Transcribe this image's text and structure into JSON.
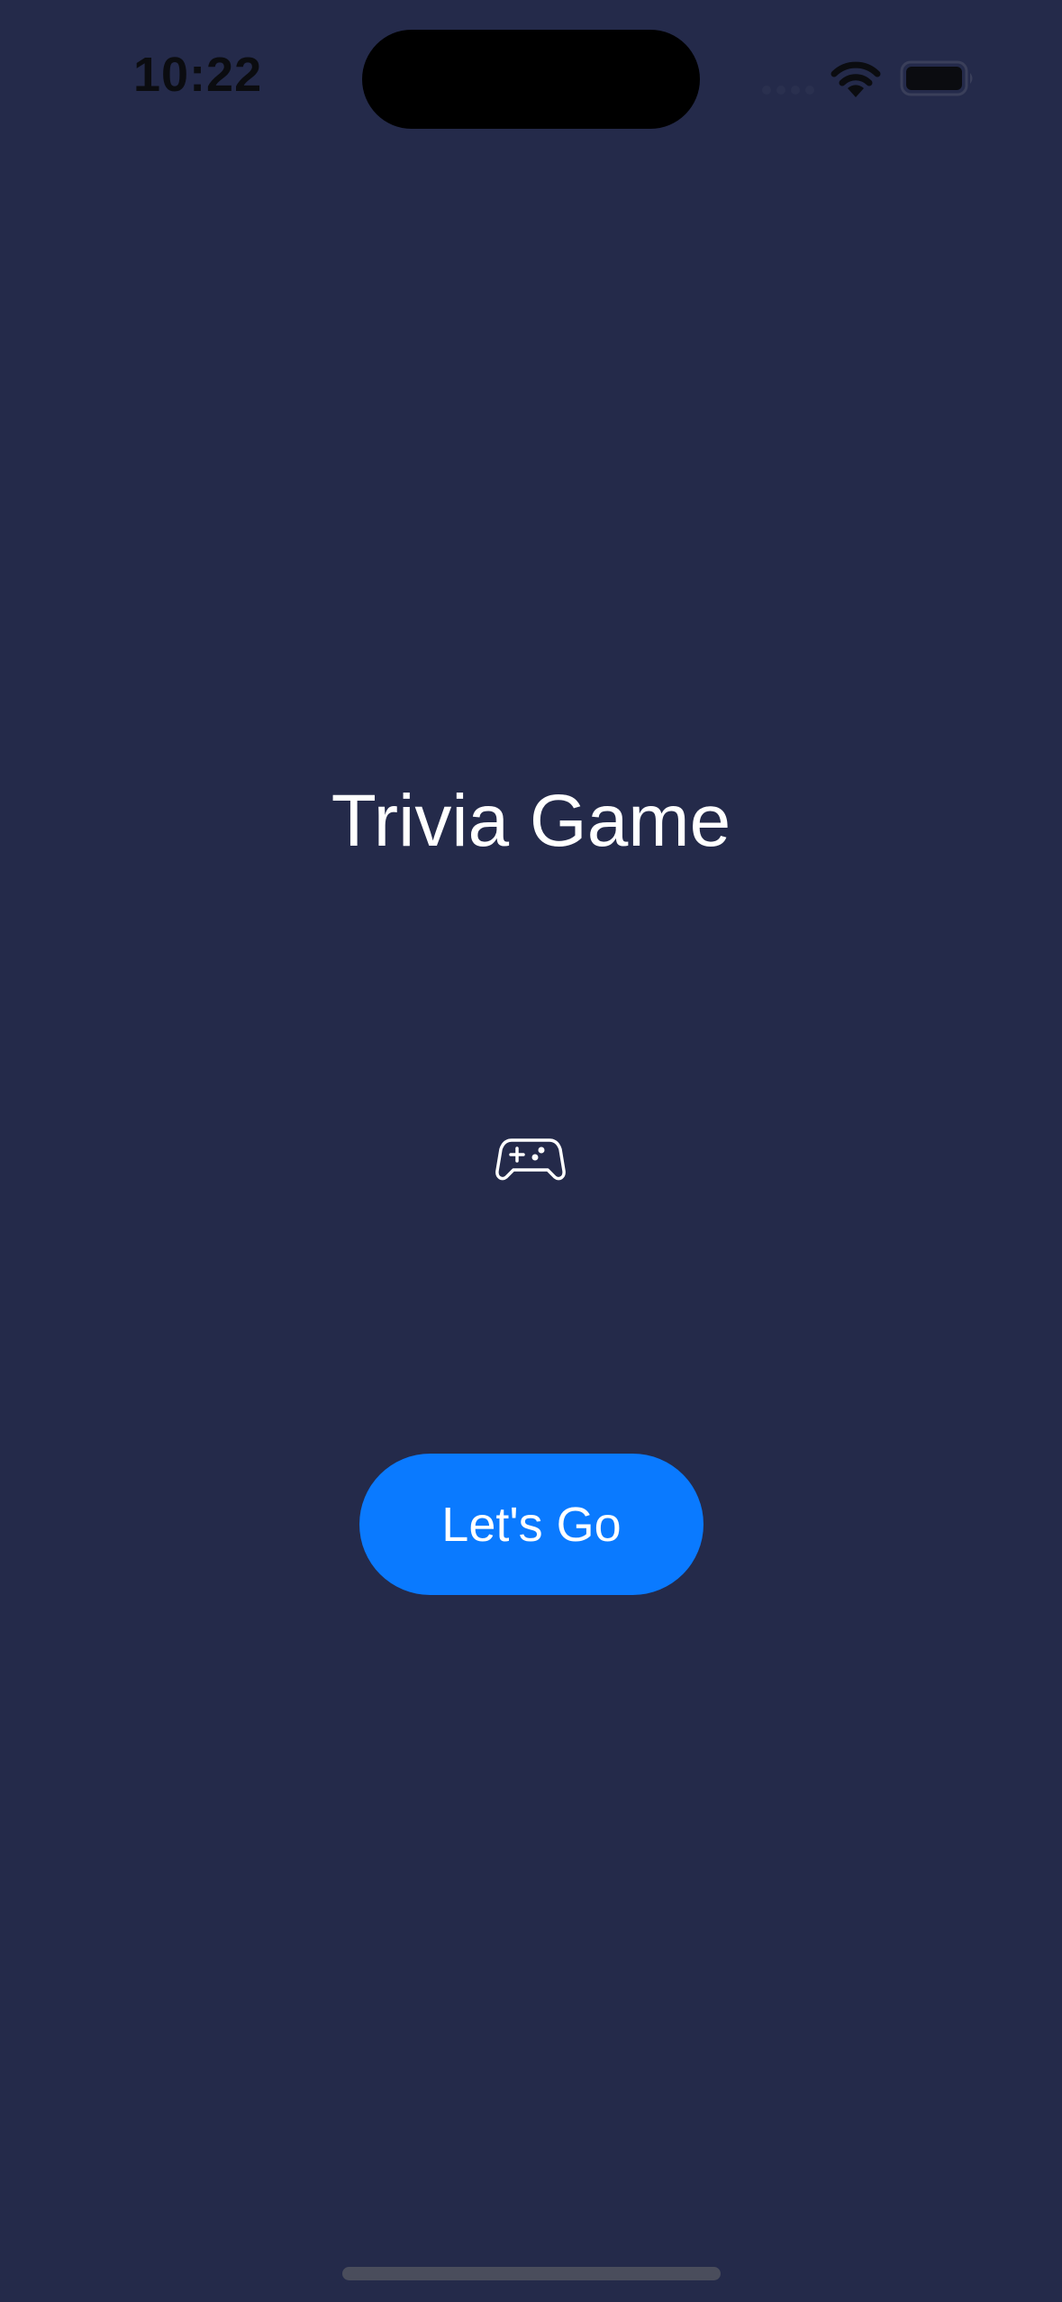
{
  "status_bar": {
    "time": "10:22"
  },
  "main": {
    "title": "Trivia Game",
    "icon": "game-controller-icon",
    "button_label": "Let's Go"
  },
  "colors": {
    "background": "#242a4a",
    "button": "#0a7aff",
    "text": "#ffffff"
  }
}
